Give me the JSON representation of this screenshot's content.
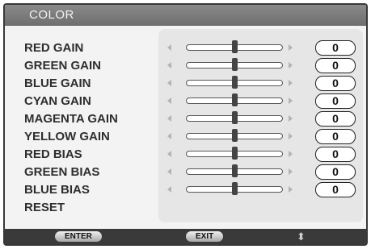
{
  "menu": {
    "title": "COLOR"
  },
  "rows": [
    {
      "label": "RED GAIN",
      "value": "0",
      "level": 0.5
    },
    {
      "label": "GREEN GAIN",
      "value": "0",
      "level": 0.5
    },
    {
      "label": "BLUE GAIN",
      "value": "0",
      "level": 0.5
    },
    {
      "label": "CYAN GAIN",
      "value": "0",
      "level": 0.5
    },
    {
      "label": "MAGENTA GAIN",
      "value": "0",
      "level": 0.5
    },
    {
      "label": "YELLOW GAIN",
      "value": "0",
      "level": 0.5
    },
    {
      "label": "RED BIAS",
      "value": "0",
      "level": 0.5
    },
    {
      "label": "GREEN BIAS",
      "value": "0",
      "level": 0.5
    },
    {
      "label": "BLUE BIAS",
      "value": "0",
      "level": 0.5
    }
  ],
  "reset": {
    "label": "RESET"
  },
  "footer": {
    "enter_label": "ENTER",
    "exit_label": "EXIT",
    "nav_icon": "up-down-arrow-icon"
  },
  "colors": {
    "frame": "#383838",
    "title_bar": "#7a7a7a",
    "panel": "#e6e6e6",
    "text": "#2e2e2e"
  }
}
